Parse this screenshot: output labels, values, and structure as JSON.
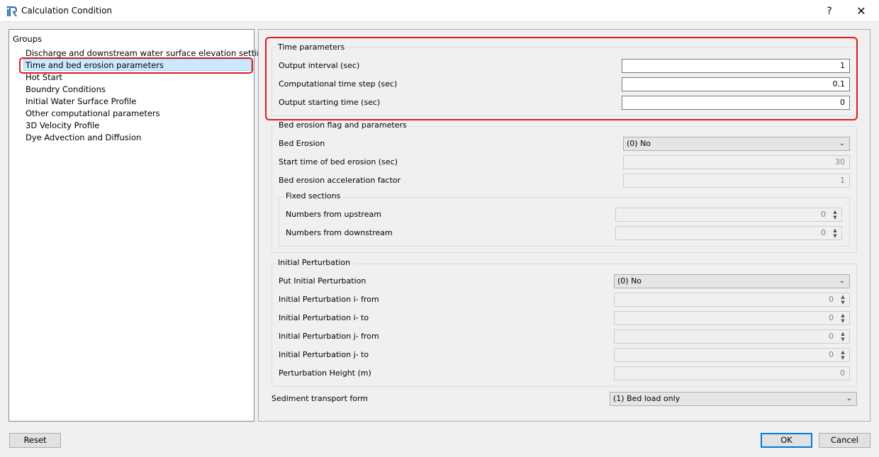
{
  "window": {
    "title": "Calculation Condition",
    "help_label": "?",
    "close_label": "✕"
  },
  "groups": {
    "label": "Groups",
    "items": [
      "Discharge and downstream water surface elevation settings",
      "Time and bed erosion parameters",
      "Hot Start",
      "Boundry Conditions",
      "Initial Water Surface Profile",
      "Other computational parameters",
      "3D Velocity Profile",
      "Dye Advection and Diffusion"
    ],
    "selected_index": 1
  },
  "time_params": {
    "title": "Time parameters",
    "output_interval_label": "Output interval (sec)",
    "output_interval_value": "1",
    "time_step_label": "Computational time step (sec)",
    "time_step_value": "0.1",
    "start_time_label": "Output starting time (sec)",
    "start_time_value": "0"
  },
  "bed_erosion": {
    "title": "Bed erosion flag and parameters",
    "flag_label": "Bed Erosion",
    "flag_value": "(0) No",
    "start_label": "Start time of bed erosion (sec)",
    "start_value": "30",
    "accel_label": "Bed erosion acceleration factor",
    "accel_value": "1",
    "fixed_title": "Fixed sections",
    "upstream_label": "Numbers from upstream",
    "upstream_value": "0",
    "downstream_label": "Numbers from downstream",
    "downstream_value": "0"
  },
  "perturbation": {
    "title": "Initial Perturbation",
    "put_label": "Put Initial Perturbation",
    "put_value": "(0) No",
    "i_from_label": "Initial Perturbation i- from",
    "i_from_value": "0",
    "i_to_label": "Initial Perturbation i- to",
    "i_to_value": "0",
    "j_from_label": "Initial Perturbation j- from",
    "j_from_value": "0",
    "j_to_label": "Initial Perturbation j- to",
    "j_to_value": "0",
    "height_label": "Perturbation Height (m)",
    "height_value": "0"
  },
  "sediment": {
    "label": "Sediment transport form",
    "value": "(1) Bed load only"
  },
  "footer": {
    "reset_label": "Reset",
    "ok_label": "OK",
    "cancel_label": "Cancel"
  },
  "colors": {
    "highlight_red": "#e0191b",
    "selection_blue": "#cce8ff",
    "default_button_border": "#0078d7"
  }
}
